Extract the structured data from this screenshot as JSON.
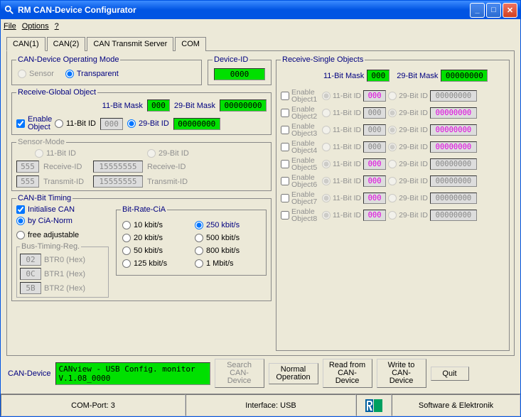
{
  "window": {
    "title": "RM CAN-Device Configurator"
  },
  "menu": {
    "file": "File",
    "options": "Options",
    "help": "?"
  },
  "tabs": [
    "CAN(1)",
    "CAN(2)",
    "CAN Transmit Server",
    "COM"
  ],
  "operatingMode": {
    "legend": "CAN-Device Operating Mode",
    "sensor": "Sensor",
    "transparent": "Transparent"
  },
  "deviceId": {
    "legend": "Device-ID",
    "value": "0000"
  },
  "globalObject": {
    "legend": "Receive-Global Object",
    "mask11Label": "11-Bit Mask",
    "mask11": "000",
    "mask29Label": "29-Bit Mask",
    "mask29": "00000000",
    "enable": "Enable Object",
    "id11Label": "11-Bit ID",
    "id11": "000",
    "id29Label": "29-Bit ID",
    "id29": "00000000"
  },
  "sensorMode": {
    "legend": "Sensor-Mode",
    "id11": "11-Bit ID",
    "id29": "29-Bit ID",
    "recvId": "Receive-ID",
    "transId": "Transmit-ID",
    "v11a": "555",
    "v11b": "555",
    "v29a": "15555555",
    "v29b": "15555555"
  },
  "bitTiming": {
    "legend": "CAN-Bit Timing",
    "init": "Initialise CAN",
    "byCia": "by CiA-Norm",
    "free": "free adjustable",
    "bitRateLegend": "Bit-Rate-CiA",
    "rates": [
      "10 kbit/s",
      "20 kbit/s",
      "50 kbit/s",
      "125 kbit/s",
      "250 kbit/s",
      "500 kbit/s",
      "800 kbit/s",
      "1 Mbit/s"
    ],
    "busTimingLegend": "Bus-Timing-Reg.",
    "btr0": "02",
    "btr0l": "BTR0 (Hex)",
    "btr1": "0C",
    "btr1l": "BTR1 (Hex)",
    "btr2": "5B",
    "btr2l": "BTR2 (Hex)"
  },
  "singleObjects": {
    "legend": "Receive-Single Objects",
    "mask11Label": "11-Bit Mask",
    "mask11": "000",
    "mask29Label": "29-Bit Mask",
    "mask29": "00000000",
    "enableLabel": "Enable",
    "id11Label": "11-Bit ID",
    "id29Label": "29-Bit ID",
    "objects": [
      {
        "name": "Object1",
        "sel": "11",
        "v11": "000",
        "v29": "00000000",
        "v29color": "gray"
      },
      {
        "name": "Object2",
        "sel": "29",
        "v11": "000",
        "v29": "00000000",
        "v29color": "magenta"
      },
      {
        "name": "Object3",
        "sel": "29",
        "v11": "000",
        "v29": "00000000",
        "v29color": "magenta"
      },
      {
        "name": "Object4",
        "sel": "29",
        "v11": "000",
        "v29": "00000000",
        "v29color": "magenta"
      },
      {
        "name": "Object5",
        "sel": "11",
        "v11": "000",
        "v29": "00000000",
        "v29color": "gray"
      },
      {
        "name": "Object6",
        "sel": "11",
        "v11": "000",
        "v29": "00000000",
        "v29color": "gray"
      },
      {
        "name": "Object7",
        "sel": "11",
        "v11": "000",
        "v29": "00000000",
        "v29color": "gray"
      },
      {
        "name": "Object8",
        "sel": "11",
        "v11": "000",
        "v29": "00000000",
        "v29color": "gray"
      }
    ]
  },
  "bottom": {
    "canDevice": "CAN-Device",
    "deviceInfo": "CANview - USB Config. monitor V.1.08_0000",
    "search": "Search CAN-Device",
    "normal": "Normal Operation",
    "read": "Read from CAN-Device",
    "write": "Write to CAN-Device",
    "quit": "Quit"
  },
  "status": {
    "comport": "COM-Port: 3",
    "interface": "Interface: USB",
    "brand": "Software & Elektronik"
  }
}
